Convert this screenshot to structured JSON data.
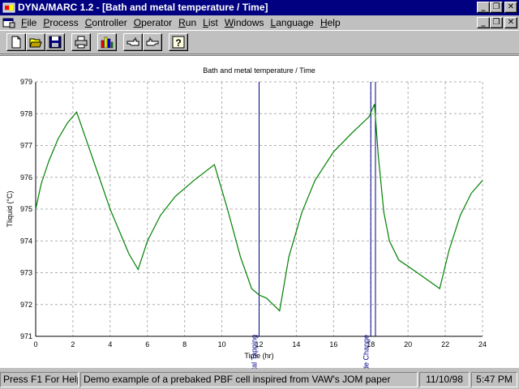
{
  "window": {
    "title": "DYNA/MARC 1.2 - [Bath and metal temperature / Time]",
    "minimize_glyph": "_",
    "restore_glyph": "❐",
    "close_glyph": "✕"
  },
  "menu": [
    {
      "label": "File",
      "u": "F",
      "rest": "ile"
    },
    {
      "label": "Process",
      "u": "P",
      "rest": "rocess"
    },
    {
      "label": "Controller",
      "u": "C",
      "rest": "ontroller"
    },
    {
      "label": "Operator",
      "u": "O",
      "rest": "perator"
    },
    {
      "label": "Run",
      "u": "R",
      "rest": "un"
    },
    {
      "label": "List",
      "u": "L",
      "rest": "ist"
    },
    {
      "label": "Windows",
      "u": "W",
      "rest": "indows"
    },
    {
      "label": "Language",
      "u": "L",
      "rest": "anguage"
    },
    {
      "label": "Help",
      "u": "H",
      "rest": "elp"
    }
  ],
  "toolbar": [
    {
      "name": "new-icon"
    },
    {
      "name": "open-folder-icon"
    },
    {
      "name": "save-disk-icon"
    },
    {
      "name": "print-icon"
    },
    {
      "name": "bar-chart-icon"
    },
    {
      "name": "hand-left-icon"
    },
    {
      "name": "hand-right-icon"
    },
    {
      "name": "help-question-icon"
    }
  ],
  "chart_data": {
    "type": "line",
    "title": "Bath and metal temperature / Time",
    "xlabel": "Time (hr)",
    "ylabel": "Tliquid (°C)",
    "xlim": [
      0,
      24
    ],
    "ylim": [
      971,
      979
    ],
    "xticks": [
      0,
      2,
      4,
      6,
      8,
      10,
      12,
      14,
      16,
      18,
      20,
      22,
      24
    ],
    "yticks": [
      971,
      972,
      973,
      974,
      975,
      976,
      977,
      978,
      979
    ],
    "grid": true,
    "line_color": "#008000",
    "marker_color": "#00008b",
    "series": [
      {
        "x": [
          0,
          0.3,
          0.7,
          1.2,
          1.7,
          2.2,
          3.0,
          4.0,
          5.0,
          5.5,
          6.0,
          6.7,
          7.5,
          8.5,
          9.6,
          10.3,
          11.0,
          11.6,
          12.0,
          12.4,
          13.1,
          13.6,
          14.3,
          15.0,
          16.0,
          17.0,
          17.9,
          18.2,
          18.4,
          18.7,
          19.0,
          19.5,
          20.5,
          21.7,
          22.2,
          22.8,
          23.4,
          24.0
        ],
        "y": [
          975.0,
          975.8,
          976.5,
          977.2,
          977.7,
          978.05,
          976.7,
          975.0,
          973.6,
          973.1,
          974.0,
          974.8,
          975.4,
          975.9,
          976.4,
          975.0,
          973.5,
          972.5,
          972.3,
          972.2,
          971.8,
          973.5,
          974.9,
          975.9,
          976.8,
          977.4,
          977.9,
          978.3,
          976.7,
          974.9,
          974.0,
          973.4,
          973.0,
          972.5,
          973.7,
          974.8,
          975.5,
          975.9
        ]
      }
    ],
    "markers": [
      {
        "x": 12.0,
        "label": "Metal Tapping"
      },
      {
        "x": 18.0,
        "label": "Anode Change"
      },
      {
        "x": 18.25,
        "label": ""
      }
    ]
  },
  "status": {
    "help": "Press F1 For Help",
    "message": "Demo example of a prebaked PBF cell inspired from VAW's JOM paper",
    "date": "11/10/98",
    "time": "5:47 PM"
  }
}
